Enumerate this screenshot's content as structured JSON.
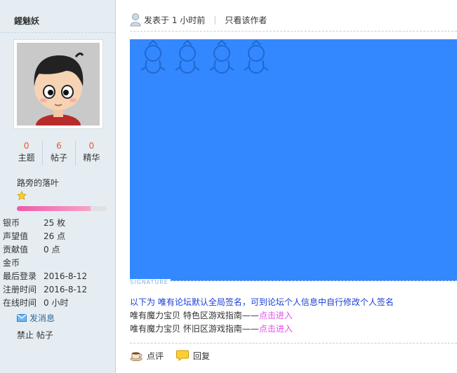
{
  "author": {
    "name": "鍟魅妖",
    "stats": [
      {
        "num": "0",
        "label": "主题"
      },
      {
        "num": "6",
        "label": "帖子"
      },
      {
        "num": "0",
        "label": "精华"
      }
    ],
    "rank_title": "路旁的落叶",
    "rank_progress": 0.82,
    "info": [
      {
        "key": "银币",
        "value": "25 枚"
      },
      {
        "key": "声望值",
        "value": "26 点"
      },
      {
        "key": "贡献值",
        "value": "0 点"
      },
      {
        "key": "金币",
        "value": ""
      },
      {
        "key": "最后登录",
        "value": "2016-8-12"
      },
      {
        "key": "注册时间",
        "value": "2016-8-12"
      },
      {
        "key": "在线时间",
        "value": "0 小时"
      }
    ],
    "pm_label": "发消息",
    "ban_label": "禁止 帖子"
  },
  "post": {
    "posted_at": "发表于 1 小时前",
    "only_author": "只看该作者",
    "signature_label": "SIGNATURE",
    "signature": {
      "line1": "以下为 唯有论坛默认全局签名，可到论坛个人信息中自行修改个人签名",
      "line2_prefix": "唯有魔力宝贝 特色区游戏指南——",
      "line2_link": "点击进入",
      "line3_prefix": "唯有魔力宝贝 怀旧区游戏指南——",
      "line3_link": "点击进入"
    },
    "actions": {
      "rate": "点评",
      "reply": "回复"
    }
  },
  "colors": {
    "content_bg": "#3388ff",
    "stat_num": "#e25a2c",
    "link_pink": "#e44fe8",
    "signature_blue": "#1a3ed6"
  },
  "icons": [
    "user-icon",
    "star-icon",
    "envelope-icon",
    "coffee-cup-icon",
    "speech-bubble-icon"
  ]
}
